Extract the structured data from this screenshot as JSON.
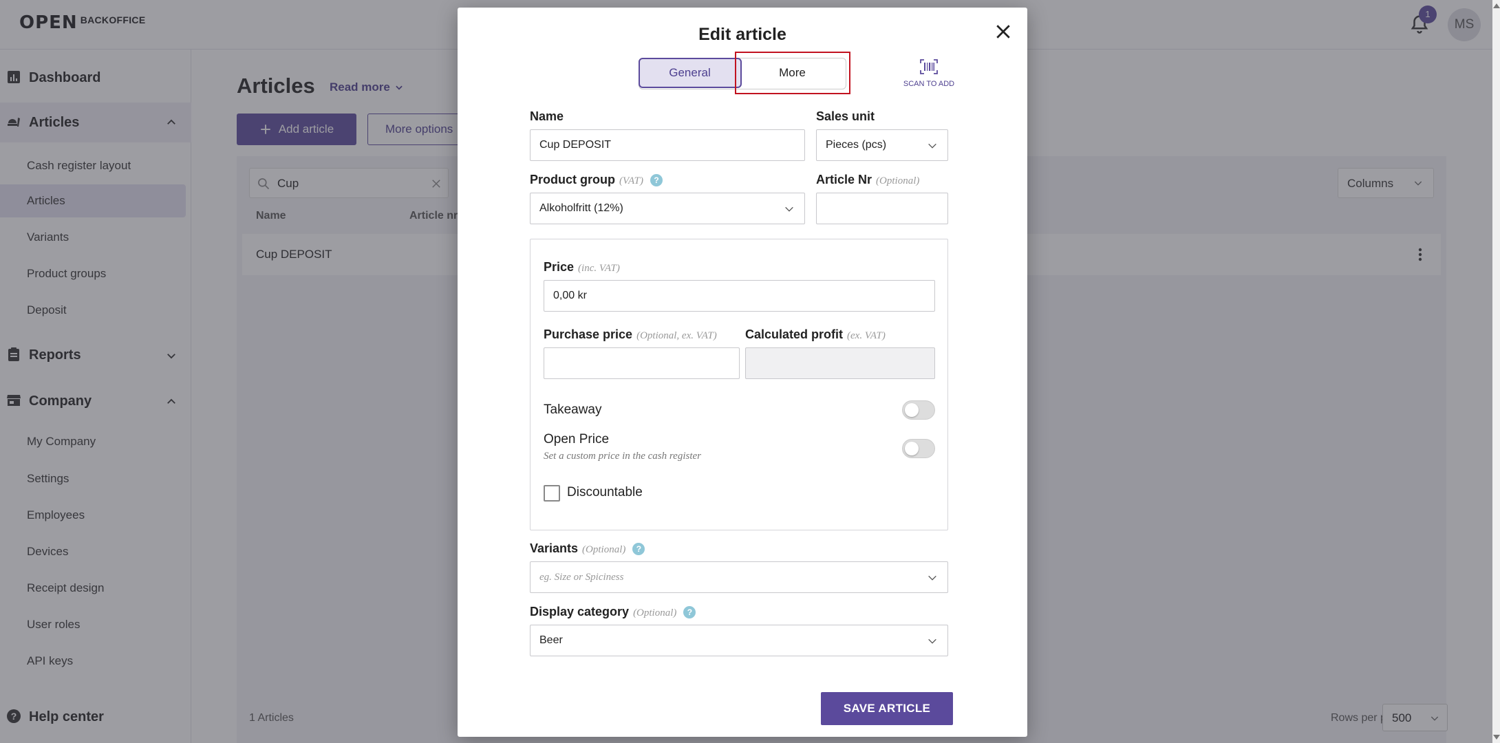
{
  "app": {
    "brand_mark": "OPEN",
    "brand_text": "BACKOFFICE",
    "notification_count": "1",
    "avatar_initials": "MS"
  },
  "sidebar": {
    "dashboard": "Dashboard",
    "articles": "Articles",
    "articles_items": [
      "Cash register layout",
      "Articles",
      "Variants",
      "Product groups",
      "Deposit"
    ],
    "reports": "Reports",
    "company": "Company",
    "company_items": [
      "My Company",
      "Settings",
      "Employees",
      "Devices",
      "Receipt design",
      "User roles",
      "API keys"
    ],
    "help_center": "Help center"
  },
  "main": {
    "title": "Articles",
    "read_more": "Read more",
    "add_article": "Add article",
    "more_options": "More options",
    "search_value": "Cup",
    "columns_label": "Columns",
    "col_name": "Name",
    "col_article_nr": "Article nr",
    "rows": [
      {
        "name": "Cup DEPOSIT"
      }
    ],
    "count_label": "1 Articles",
    "rows_per_page_label": "Rows per page",
    "rows_per_page_value": "500"
  },
  "modal": {
    "title": "Edit article",
    "tab_general": "General",
    "tab_more": "More",
    "scan_label": "SCAN TO ADD",
    "name_label": "Name",
    "name_value": "Cup DEPOSIT",
    "sales_unit_label": "Sales unit",
    "sales_unit_value": "Pieces (pcs)",
    "product_group_label": "Product group",
    "product_group_hint": "(VAT)",
    "product_group_value": "Alkoholfritt (12%)",
    "article_nr_label": "Article Nr",
    "article_nr_hint": "(Optional)",
    "article_nr_value": "",
    "price_label": "Price",
    "price_hint": "(inc. VAT)",
    "price_value": "0,00 kr",
    "purchase_price_label": "Purchase price",
    "purchase_price_hint": "(Optional, ex. VAT)",
    "purchase_price_value": "",
    "calc_profit_label": "Calculated profit",
    "calc_profit_hint": "(ex. VAT)",
    "calc_profit_value": "",
    "takeaway_label": "Takeaway",
    "takeaway_on": false,
    "open_price_label": "Open Price",
    "open_price_sub": "Set a custom price in the cash register",
    "open_price_on": false,
    "discountable_label": "Discountable",
    "discountable_checked": false,
    "variants_label": "Variants",
    "variants_hint": "(Optional)",
    "variants_placeholder": "eg. Size or Spiciness",
    "display_category_label": "Display category",
    "display_category_hint": "(Optional)",
    "display_category_value": "Beer",
    "save_label": "SAVE ARTICLE",
    "help_glyph": "?"
  },
  "colors": {
    "primary": "#5b4a9c",
    "active_bg": "#e3e0f0",
    "highlight": "#c1121f",
    "help_icon": "#8fc7d8"
  }
}
